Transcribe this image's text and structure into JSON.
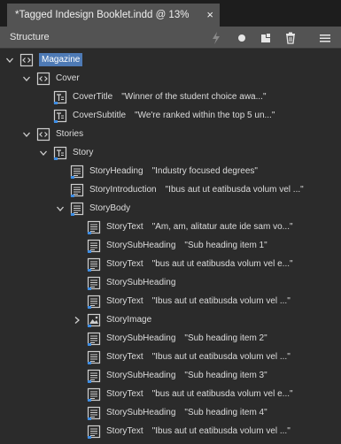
{
  "tab": {
    "title": "*Tagged Indesign Booklet.indd @ 13%",
    "close_glyph": "×"
  },
  "panel": {
    "title": "Structure",
    "toolbar_icons": [
      "lightning-icon",
      "record-icon",
      "new-element-icon",
      "trash-icon",
      "menu-icon"
    ]
  },
  "tree": [
    {
      "name": "magazine",
      "type": "element",
      "label": "Magazine",
      "snippet": "",
      "expanded": true,
      "selected": true
    },
    {
      "name": "cover",
      "type": "element",
      "label": "Cover",
      "snippet": "",
      "expanded": true
    },
    {
      "name": "covertitle",
      "type": "text",
      "label": "CoverTitle",
      "snippet": "\"Winner of the student choice awa...\""
    },
    {
      "name": "coversubtitle",
      "type": "text",
      "label": "CoverSubtitle",
      "snippet": "\"We're ranked within the top 5 un...\""
    },
    {
      "name": "stories",
      "type": "element",
      "label": "Stories",
      "snippet": "",
      "expanded": true
    },
    {
      "name": "story",
      "type": "text",
      "label": "Story",
      "snippet": "",
      "expanded": true
    },
    {
      "name": "storyheading",
      "type": "frame",
      "label": "StoryHeading",
      "snippet": "\"Industry focused degrees\""
    },
    {
      "name": "storyintroduction",
      "type": "frame",
      "label": "StoryIntroduction",
      "snippet": "\"Ibus aut ut eatibusda volum vel ...\""
    },
    {
      "name": "storybody",
      "type": "frame",
      "label": "StoryBody",
      "snippet": "",
      "expanded": true
    },
    {
      "name": "storytext-1",
      "type": "frame",
      "label": "StoryText",
      "snippet": "\"Am, am, alitatur aute ide sam vo...\""
    },
    {
      "name": "storysubheading-1",
      "type": "frame",
      "label": "StorySubHeading",
      "snippet": "\"Sub heading item 1\""
    },
    {
      "name": "storytext-2",
      "type": "frame",
      "label": "StoryText",
      "snippet": "\"bus aut ut eatibusda volum vel e...\""
    },
    {
      "name": "storysubheading-2",
      "type": "frame",
      "label": "StorySubHeading",
      "snippet": ""
    },
    {
      "name": "storytext-3",
      "type": "frame",
      "label": "StoryText",
      "snippet": "\"Ibus aut ut eatibusda volum vel ...\""
    },
    {
      "name": "storyimage",
      "type": "image",
      "label": "StoryImage",
      "snippet": "",
      "expanded": false
    },
    {
      "name": "storysubheading-3",
      "type": "frame",
      "label": "StorySubHeading",
      "snippet": "\"Sub heading item 2\""
    },
    {
      "name": "storytext-4",
      "type": "frame",
      "label": "StoryText",
      "snippet": "\"Ibus aut ut eatibusda volum vel ...\""
    },
    {
      "name": "storysubheading-4",
      "type": "frame",
      "label": "StorySubHeading",
      "snippet": "\"Sub heading item 3\""
    },
    {
      "name": "storytext-5",
      "type": "frame",
      "label": "StoryText",
      "snippet": "\"bus aut ut eatibusda volum vel e...\""
    },
    {
      "name": "storysubheading-5",
      "type": "frame",
      "label": "StorySubHeading",
      "snippet": "\"Sub heading item 4\""
    },
    {
      "name": "storytext-6",
      "type": "frame",
      "label": "StoryText",
      "snippet": "\"Ibus aut ut eatibusda volum vel ...\""
    }
  ],
  "colors": {
    "selection": "#4e7ab5",
    "tag_badge": "#3d8ee6",
    "panel_bg": "#2b2b2b",
    "header_bg": "#535353"
  }
}
